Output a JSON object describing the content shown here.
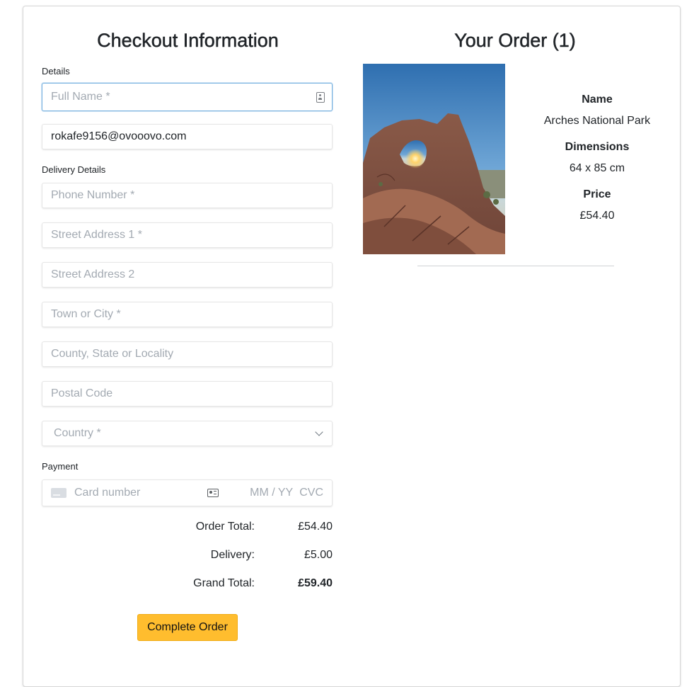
{
  "checkout": {
    "title": "Checkout Information",
    "details_label": "Details",
    "full_name_placeholder": "Full Name *",
    "email_value": "rokafe9156@ovooovo.com",
    "delivery_label": "Delivery Details",
    "phone_placeholder": "Phone Number *",
    "street1_placeholder": "Street Address 1 *",
    "street2_placeholder": "Street Address 2",
    "town_placeholder": "Town or City *",
    "county_placeholder": "County, State or Locality",
    "postal_placeholder": "Postal Code",
    "country_selected": "Country *",
    "payment_label": "Payment",
    "card_number_placeholder": "Card number",
    "expiry_placeholder": "MM / YY",
    "cvc_placeholder": "CVC"
  },
  "totals": {
    "order_total_label": "Order Total:",
    "order_total_value": "£54.40",
    "delivery_label": "Delivery:",
    "delivery_value": "£5.00",
    "grand_total_label": "Grand Total:",
    "grand_total_value": "£59.40"
  },
  "complete_order_label": "Complete Order",
  "order": {
    "title": "Your Order (1)",
    "item": {
      "name_label": "Name",
      "name_value": "Arches National Park",
      "dimensions_label": "Dimensions",
      "dimensions_value": "64 x 85 cm",
      "price_label": "Price",
      "price_value": "£54.40"
    }
  },
  "icons": [
    "contact-card-icon",
    "chevron-down-icon",
    "credit-card-icon",
    "autofill-card-icon"
  ],
  "colors": {
    "button": "#ffbd2e",
    "focus_border": "#7ab3e0",
    "placeholder": "#a3aab2"
  }
}
